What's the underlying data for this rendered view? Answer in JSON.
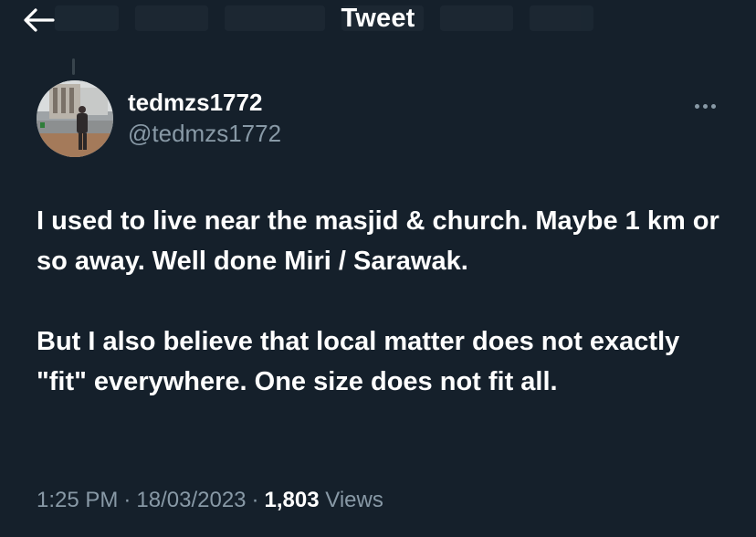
{
  "header": {
    "title": "Tweet",
    "back_icon": "arrow-left-icon"
  },
  "tweet": {
    "author": {
      "display_name": "tedmzs1772",
      "username": "@tedmzs1772"
    },
    "more_icon": "more-horizontal-icon",
    "body_paragraphs": [
      "I used to live near the masjid & church. Maybe 1 km or so away. Well done Miri / Sarawak.",
      "But I also believe that local matter does not exactly \"fit\" everywhere. One size does not fit all."
    ],
    "meta": {
      "time": "1:25 PM",
      "separator": "·",
      "date": "18/03/2023",
      "views_count": "1,803",
      "views_label": "Views"
    }
  },
  "colors": {
    "background": "#15202b",
    "primary_text": "#ffffff",
    "secondary_text": "#8899a6",
    "divider": "#38444d"
  }
}
